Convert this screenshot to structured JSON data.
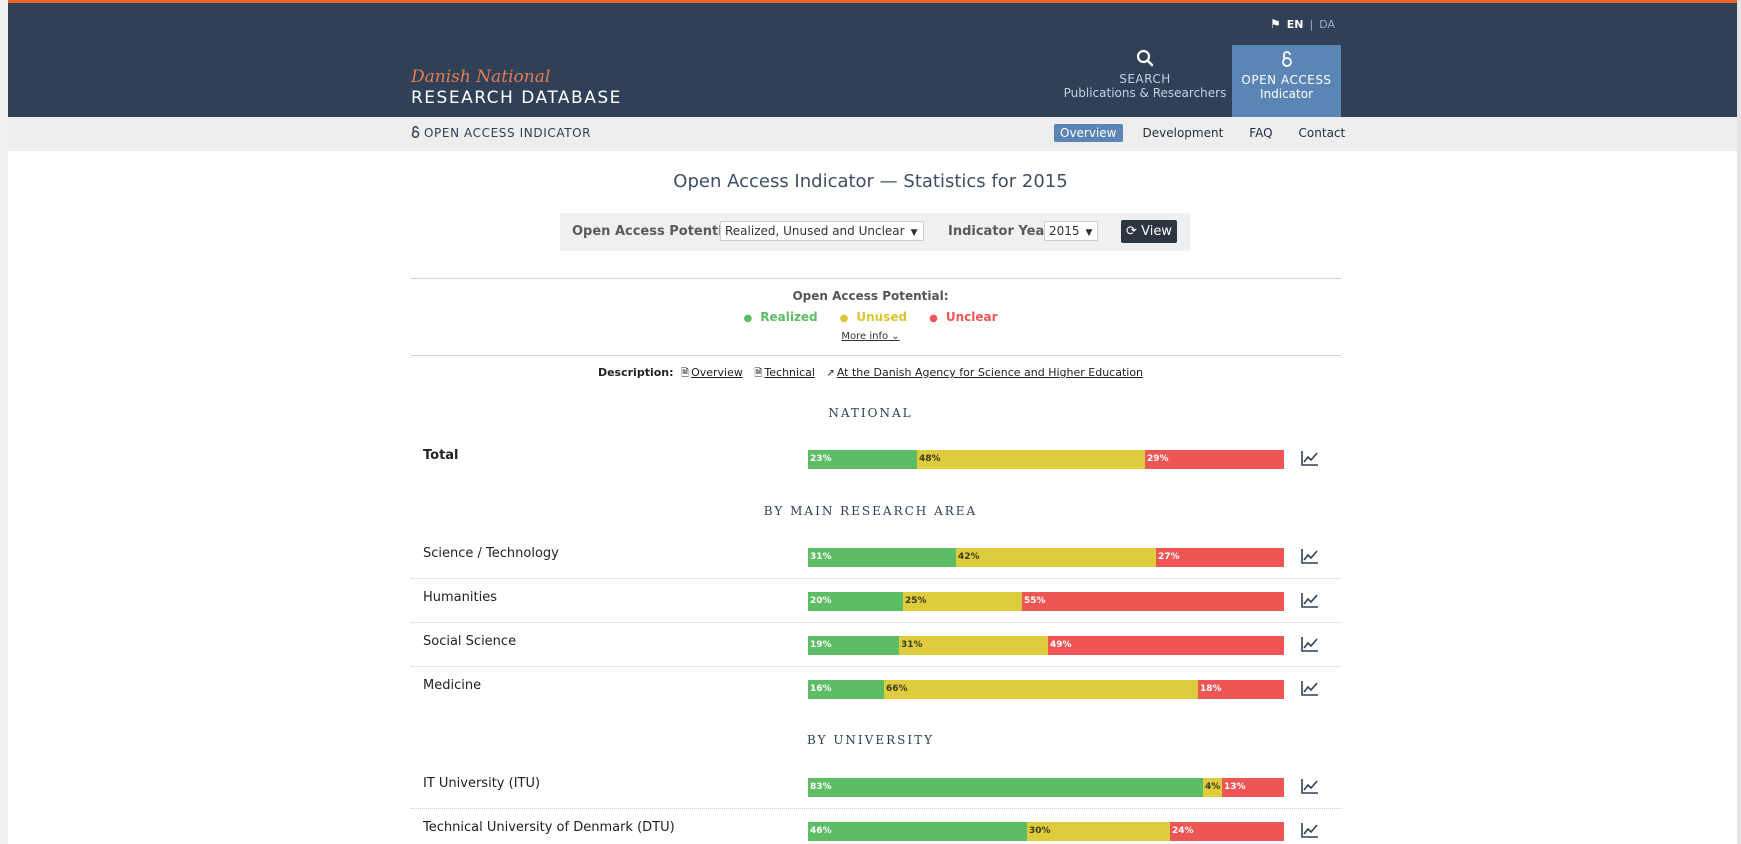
{
  "colors": {
    "header_bg": "#2f4057",
    "accent_orange": "#e8662b",
    "active_blue": "#5b85b5",
    "realized_green": "#5cbd65",
    "unused_yellow": "#decc3c",
    "unclear_red": "#ed5654"
  },
  "lang": {
    "active": "EN",
    "separator": "|",
    "inactive": "DA",
    "icon": "flag-icon"
  },
  "brand": {
    "line1": "Danish National",
    "line2": "RESEARCH DATABASE"
  },
  "nav": {
    "search": {
      "icon": "search-icon",
      "line1": "SEARCH",
      "line2": "Publications & Researchers"
    },
    "open_access": {
      "icon": "open-lock-icon",
      "line1": "OPEN ACCESS",
      "line2": "Indicator"
    }
  },
  "subnav": {
    "title": "OPEN ACCESS INDICATOR",
    "title_icon": "open-lock-icon",
    "links": [
      "Overview",
      "Development",
      "FAQ",
      "Contact"
    ],
    "active": "Overview"
  },
  "page_title": "Open Access Indicator — Statistics for 2015",
  "filter": {
    "potential_label": "Open Access Potential",
    "potential_value": "Realized, Unused and Unclear",
    "year_label": "Indicator Year",
    "year_value": "2015",
    "view_label": "View",
    "view_icon": "refresh-icon"
  },
  "legend": {
    "title": "Open Access Potential:",
    "items": [
      {
        "label": "Realized",
        "color": "#5cbd65"
      },
      {
        "label": "Unused",
        "color": "#decc3c"
      },
      {
        "label": "Unclear",
        "color": "#ed5654"
      }
    ],
    "more_info": "More info ⌄"
  },
  "description": {
    "label": "Description:",
    "links": [
      {
        "icon": "document-icon",
        "text": "Overview"
      },
      {
        "icon": "document-icon",
        "text": "Technical"
      },
      {
        "icon": "external-link-icon",
        "text": "At the Danish Agency for Science and Higher Education"
      }
    ]
  },
  "sections": {
    "national": "NATIONAL",
    "area": "BY MAIN RESEARCH AREA",
    "university": "BY UNIVERSITY"
  },
  "rows": [
    {
      "name": "Total",
      "realized": 23,
      "unused": 48,
      "unclear": 29
    },
    {
      "name": "Science / Technology",
      "realized": 31,
      "unused": 42,
      "unclear": 27
    },
    {
      "name": "Humanities",
      "realized": 20,
      "unused": 25,
      "unclear": 55
    },
    {
      "name": "Social Science",
      "realized": 19,
      "unused": 31,
      "unclear": 49
    },
    {
      "name": "Medicine",
      "realized": 16,
      "unused": 66,
      "unclear": 18
    },
    {
      "name": "IT University (ITU)",
      "realized": 83,
      "unused": 4,
      "unclear": 13
    },
    {
      "name": "Technical University of Denmark (DTU)",
      "realized": 46,
      "unused": 30,
      "unclear": 24
    }
  ],
  "row_icon": "line-chart-icon"
}
